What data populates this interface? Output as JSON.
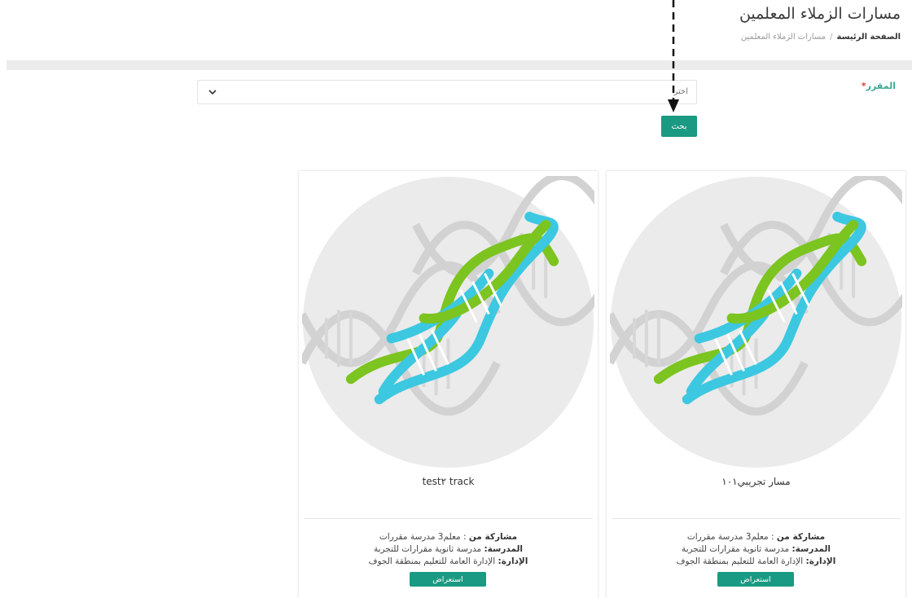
{
  "header": {
    "title": "مسارات الزملاء المعلمين",
    "breadcrumb": {
      "home": "الصفحة الرئيسة",
      "separator": "/",
      "current": "مسارات الزملاء المعلمين"
    }
  },
  "filter": {
    "label": "المقرر",
    "required_mark": "*",
    "select_value": "اختر",
    "search_label": "بحث"
  },
  "cards": [
    {
      "title": "test۲ track",
      "shared_by_label": "مشاركة من",
      "shared_by_value": ": معلم3 مدرسة مقررات",
      "school_label": "المدرسة:",
      "school_value": "مدرسة ثانوية مقرارات للتجربة",
      "admin_label": "الإدارة:",
      "admin_value": "الإدارة العامة للتعليم بمنطقة الجوف",
      "view_label": "استعراض"
    },
    {
      "title": "مسار تجريبي١٠١",
      "shared_by_label": "مشاركة من",
      "shared_by_value": ": معلم3 مدرسة مقررات",
      "school_label": "المدرسة:",
      "school_value": "مدرسة ثانوية مقرارات للتجربة",
      "admin_label": "الإدارة:",
      "admin_value": "الإدارة العامة للتعليم بمنطقة الجوف",
      "view_label": "استعراض"
    }
  ],
  "colors": {
    "accent": "#1a9a82",
    "label_green": "#3aa693",
    "dna_blue": "#3cc8e0",
    "dna_green": "#7cc41f"
  },
  "icons": {
    "select_arrow": "chevron-down-icon",
    "card_image": "dna-helix-icon",
    "annotation": "dashed-arrow-down-icon"
  }
}
